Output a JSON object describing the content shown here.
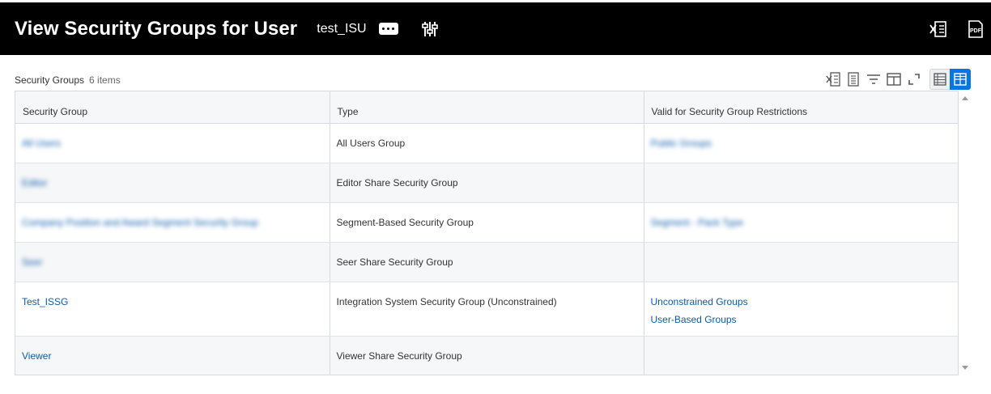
{
  "header": {
    "title": "View Security Groups for User",
    "subject": "test_ISU",
    "more_icon": "ellipsis-icon",
    "related_icon": "sliders-icon",
    "excel_icon": "excel-export-icon",
    "pdf_icon": "pdf-export-icon",
    "pdf_label": "PDF"
  },
  "grid": {
    "title": "Security Groups",
    "count": "6 items",
    "toolbar_icons": [
      "excel-export-icon",
      "print-icon",
      "filter-icon",
      "columns-icon",
      "fullscreen-icon"
    ],
    "view_toggle": [
      "table-view-icon",
      "grid-view-icon"
    ],
    "columns": [
      "Security Group",
      "Type",
      "Valid for Security Group Restrictions"
    ],
    "rows": [
      {
        "group": "All Users",
        "type": "All Users Group",
        "restrictions": [
          "Public Groups"
        ],
        "blurred": true
      },
      {
        "group": "Editor",
        "type": "Editor Share Security Group",
        "restrictions": [],
        "blurred": true
      },
      {
        "group": "Company Position and Award Segment Security Group",
        "type": "Segment-Based Security Group",
        "restrictions": [
          "Segment - Pack Type"
        ],
        "blurred": true
      },
      {
        "group": "Seer",
        "type": "Seer Share Security Group",
        "restrictions": [],
        "blurred": true
      },
      {
        "group": "Test_ISSG",
        "type": "Integration System Security Group (Unconstrained)",
        "restrictions": [
          "Unconstrained Groups",
          "User-Based Groups"
        ],
        "blurred": false
      },
      {
        "group": "Viewer",
        "type": "Viewer Share Security Group",
        "restrictions": [],
        "blurred": false
      }
    ]
  },
  "colors": {
    "header_bg": "#000000",
    "link": "#0b5cad",
    "accent": "#0875e1",
    "alt_row": "#f6f7f8"
  }
}
